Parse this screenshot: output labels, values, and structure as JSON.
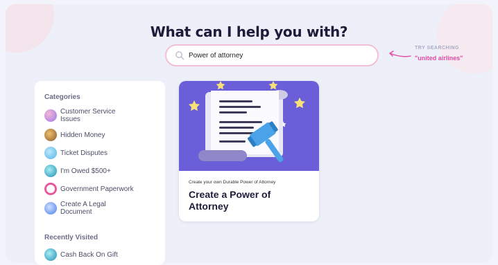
{
  "header": {
    "title": "What can I help you with?"
  },
  "search": {
    "value": "Power of attorney",
    "placeholder": ""
  },
  "try_searching": {
    "label": "TRY SEARCHING",
    "value": "\"united airlines\""
  },
  "sidebar": {
    "categories_heading": "Categories",
    "items": [
      {
        "label": "Customer Service Issues",
        "icon": "chat-icon",
        "color": "#9b7be8"
      },
      {
        "label": "Hidden Money",
        "icon": "money-stack-icon",
        "color": "#c98a3c"
      },
      {
        "label": "Ticket Disputes",
        "icon": "ticket-icon",
        "color": "#4fb3e6"
      },
      {
        "label": "I'm Owed $500+",
        "icon": "cash-icon",
        "color": "#2eb8c9"
      },
      {
        "label": "Government Paperwork",
        "icon": "government-icon",
        "color": "#e85a9a"
      },
      {
        "label": "Create A Legal Document",
        "icon": "document-icon",
        "color": "#4a7de8"
      }
    ],
    "recent_heading": "Recently Visited",
    "recent_items": [
      {
        "label": "Cash Back On Gift",
        "icon": "gift-card-icon",
        "color": "#2eb8c9"
      }
    ]
  },
  "card": {
    "subtitle": "Create your own Durable Power of Attorney",
    "title": "Create a Power of Attorney"
  },
  "colors": {
    "accent": "#e14aa6",
    "card_bg": "#6a5fd8",
    "gavel": "#4aa3e8"
  }
}
